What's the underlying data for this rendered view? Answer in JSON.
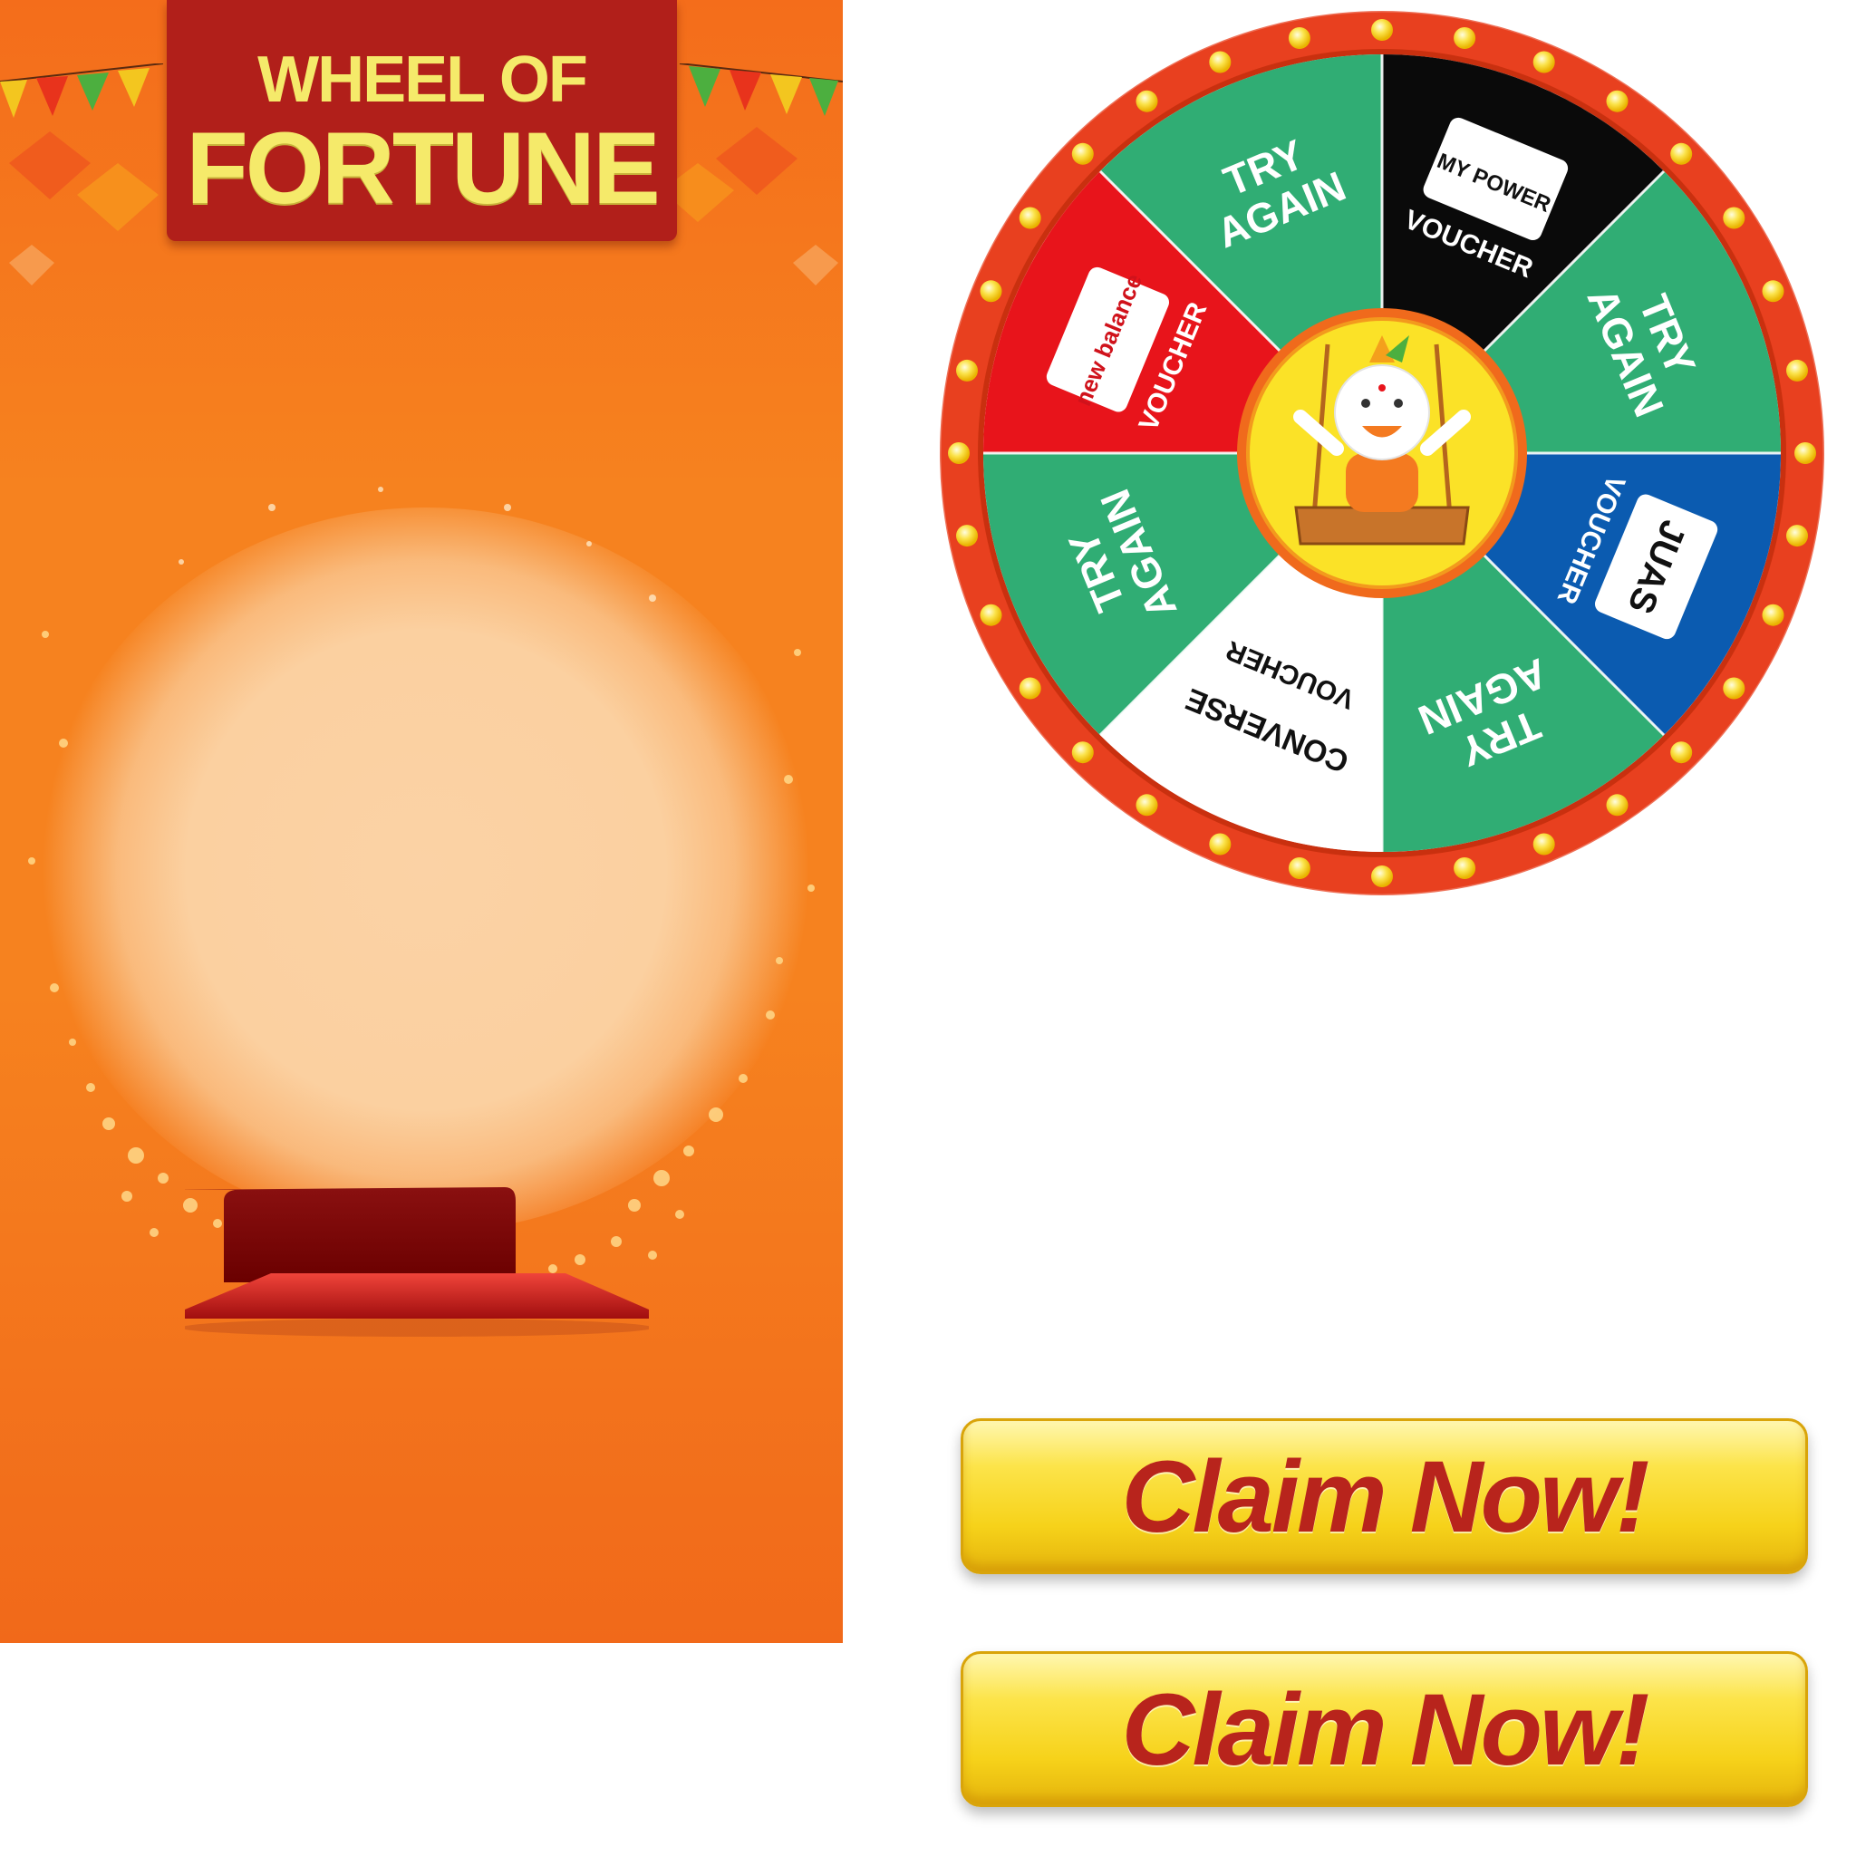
{
  "banner": {
    "title_line1": "WHEEL OF",
    "title_line2": "FORTUNE"
  },
  "wheel": {
    "segments": [
      {
        "label_line1": "MY POWER",
        "label_line2": "VOUCHER",
        "color": "#0a0a0a"
      },
      {
        "label_line1": "TRY",
        "label_line2": "AGAIN",
        "color": "#30ad74"
      },
      {
        "label_line1": "JUAS",
        "label_line2": "VOUCHER",
        "color": "#0b5bb0"
      },
      {
        "label_line1": "TRY",
        "label_line2": "AGAIN",
        "color": "#30ad74"
      },
      {
        "label_line1": "CONVERSE",
        "label_line2": "VOUCHER",
        "color": "#ffffff"
      },
      {
        "label_line1": "TRY",
        "label_line2": "AGAIN",
        "color": "#30ad74"
      },
      {
        "label_line1": "new balance",
        "label_line2": "VOUCHER",
        "color": "#e8141b"
      },
      {
        "label_line1": "TRY",
        "label_line2": "AGAIN",
        "color": "#30ad74"
      }
    ],
    "rim_color": "#e8401f",
    "bulb_color": "#fbe34a",
    "hub_color": "#fbe227"
  },
  "buttons": {
    "claim_1": "Claim Now!",
    "claim_2": "Claim Now!"
  },
  "colors": {
    "panel_orange": "#f6821f",
    "banner_red": "#b11f1a",
    "title_yellow": "#f5ea6a",
    "button_text": "#b8241c"
  }
}
